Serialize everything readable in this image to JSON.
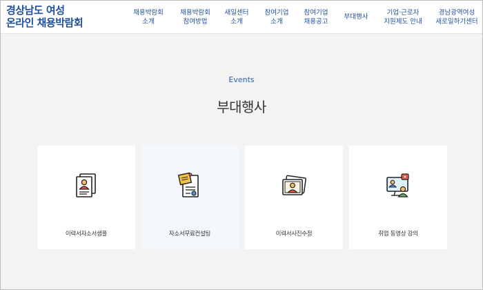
{
  "header": {
    "logo": {
      "line1": "경상남도 여성",
      "line2": "온라인 채용박람회"
    },
    "nav": [
      {
        "line1": "채용박람회",
        "line2": "소개"
      },
      {
        "line1": "채용박람회",
        "line2": "참여방법"
      },
      {
        "line1": "새일센터",
        "line2": "소개"
      },
      {
        "line1": "참여기업",
        "line2": "소개"
      },
      {
        "line1": "참여기업",
        "line2": "채용공고"
      },
      {
        "line1": "부대행사",
        "line2": ""
      },
      {
        "line1": "기업·근로자",
        "line2": "지원제도 안내"
      },
      {
        "line1": "경남광역여성",
        "line2": "새로일하기센터"
      }
    ]
  },
  "main": {
    "subtitle": "Events",
    "title": "부대행사",
    "cards": [
      {
        "label": "이력서자소서샘플",
        "icon": "resume-icon"
      },
      {
        "label": "자소서무료컨설팅",
        "icon": "consulting-document-icon"
      },
      {
        "label": "이력서사진수정",
        "icon": "photo-edit-icon"
      },
      {
        "label": "취업 동영상 강의",
        "icon": "video-lecture-icon"
      }
    ]
  },
  "colors": {
    "brand": "#1f4e9e",
    "accent": "#2f5fb0",
    "background": "#f3f3f4"
  }
}
